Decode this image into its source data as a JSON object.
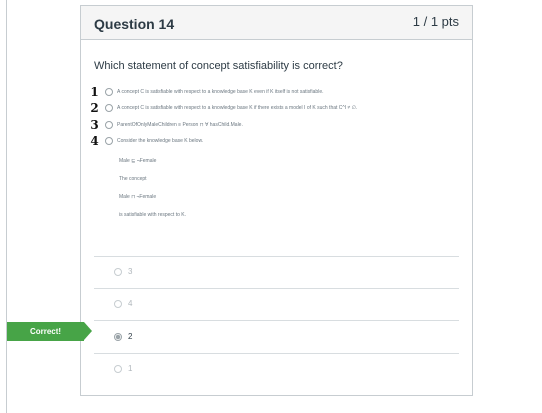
{
  "question": {
    "title": "Question 14",
    "points": "1 / 1 pts",
    "prompt": "Which statement of concept satisfiability is correct?"
  },
  "options": [
    {
      "hand": "1",
      "text": "A concept C is satisfiable with respect to a knowledge base K even if K itself is not satisfiable."
    },
    {
      "hand": "2",
      "text": "A concept C is satisfiable with respect to a knowledge base K if there exists a model I of K such that C^I ≠ ∅."
    },
    {
      "hand": "3",
      "text": "ParentOfOnlyMaleChildren ≡ Person ⊓ ∀ hasChild.Male."
    },
    {
      "hand": "4",
      "text": "Consider the knowledge base K below."
    }
  ],
  "option4_detail": [
    "Male ⊑ ¬Female",
    "The concept",
    "Male ⊓ ¬Female",
    "is satisfiable with respect to K."
  ],
  "answers": [
    {
      "label": "3",
      "selected": false
    },
    {
      "label": "4",
      "selected": false
    },
    {
      "label": "2",
      "selected": true
    },
    {
      "label": "1",
      "selected": false
    }
  ],
  "result_tag": "Correct!"
}
